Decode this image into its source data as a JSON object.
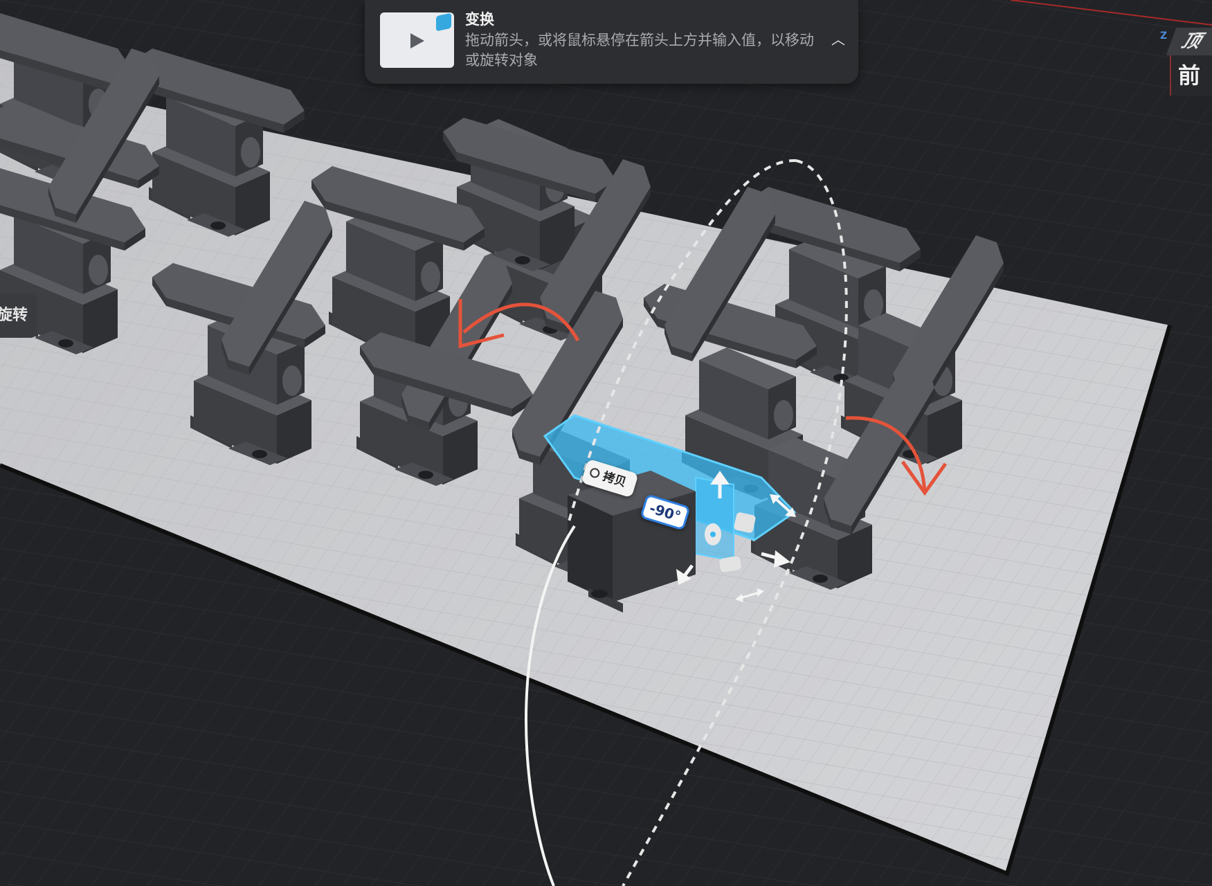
{
  "tooltip": {
    "title": "变换",
    "body": "拖动箭头，或将鼠标悬停在箭头上方并输入值，以移动或旋转对象",
    "thumbnail_icon": "play-icon",
    "collapse_icon": "chevron-up-icon"
  },
  "side_chip": {
    "label": "旋转"
  },
  "view_cube": {
    "top_label": "顶",
    "front_label": "前",
    "axis_label": "Z"
  },
  "gizmo": {
    "copy_label": "拷贝",
    "copy_icon": "copy-icon",
    "angle_value": "-90°"
  },
  "colors": {
    "background": "#222326",
    "plate": "#c8c9cc",
    "part": "#4a4b50",
    "selection": "#3ab8f0",
    "rotation_arrow": "#e4533a",
    "axis_x": "#b03030",
    "axis_z": "#4a8ad8"
  }
}
